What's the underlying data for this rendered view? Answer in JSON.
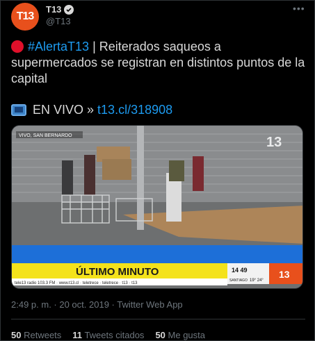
{
  "account": {
    "display_name": "T13",
    "handle": "@T13",
    "avatar_text": "T13"
  },
  "tweet": {
    "hashtag": "#AlertaT13",
    "text_rest": " | Reiterados saqueos a supermercados se registran en distintos puntos de la capital",
    "live_label": "EN VIVO »",
    "live_link": "t13.cl/318908",
    "timestamp": "2:49 p. m. · 20 oct. 2019 · Twitter Web App"
  },
  "media": {
    "location_tag": "VIVO, SAN BERNARDO",
    "channel_logo": "13",
    "banner_text": "ÚLTIMO MINUTO",
    "clock": "14 49",
    "city": "SANTIAGO",
    "temps": "19° 24°",
    "ticker": "tele13 radio 103.3 FM  ·  www.t13.cl  ·  teletrece  ·  teletrece  ·  t13  ·  t13"
  },
  "stats": [
    {
      "count": "50",
      "label": "Retweets"
    },
    {
      "count": "11",
      "label": "Tweets citados"
    },
    {
      "count": "50",
      "label": "Me gusta"
    }
  ],
  "colors": {
    "accent": "#1d9bf0",
    "brand": "#e8501c",
    "background": "#000000"
  }
}
